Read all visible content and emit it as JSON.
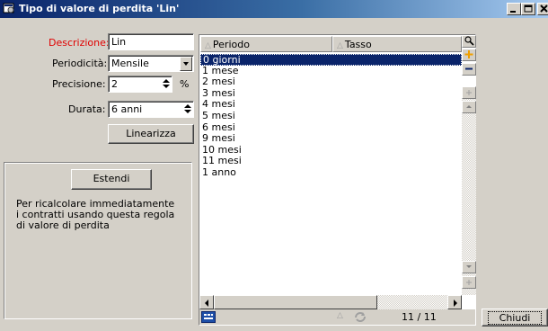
{
  "window": {
    "title": "Tipo di valore di perdita 'Lin'",
    "icon": "window-app-icon",
    "controls": [
      "minimize-icon",
      "maximize-icon",
      "close-icon"
    ]
  },
  "form": {
    "descrizione": {
      "label": "Descrizione:",
      "value": "Lin",
      "label_color": "#e00000"
    },
    "periodicita": {
      "label": "Periodicità:",
      "value": "Mensile"
    },
    "precisione": {
      "label": "Precisione:",
      "value": "2",
      "unit": "%"
    },
    "durata": {
      "label": "Durata:",
      "value": "6 anni"
    },
    "linearizza_button": "Linearizza"
  },
  "extend": {
    "button": "Estendi",
    "description": "Per ricalcolare immediatamente i contratti usando questa regola di valore di perdita"
  },
  "list": {
    "columns": [
      "Periodo",
      "Tasso"
    ],
    "rows": [
      "0 giorni",
      "1 mese",
      "2 mesi",
      "3 mesi",
      "4 mesi",
      "5 mesi",
      "6 mesi",
      "9 mesi",
      "10 mesi",
      "11 mesi",
      "1 anno"
    ],
    "selected_index": 0,
    "selection_color": "#0a246a",
    "side_buttons": [
      "search-icon",
      "add-icon",
      "remove-icon",
      "small-add-icon",
      "scroll-up-icon"
    ],
    "count": "11 / 11"
  },
  "footer": {
    "close_button": "Chiudi"
  }
}
